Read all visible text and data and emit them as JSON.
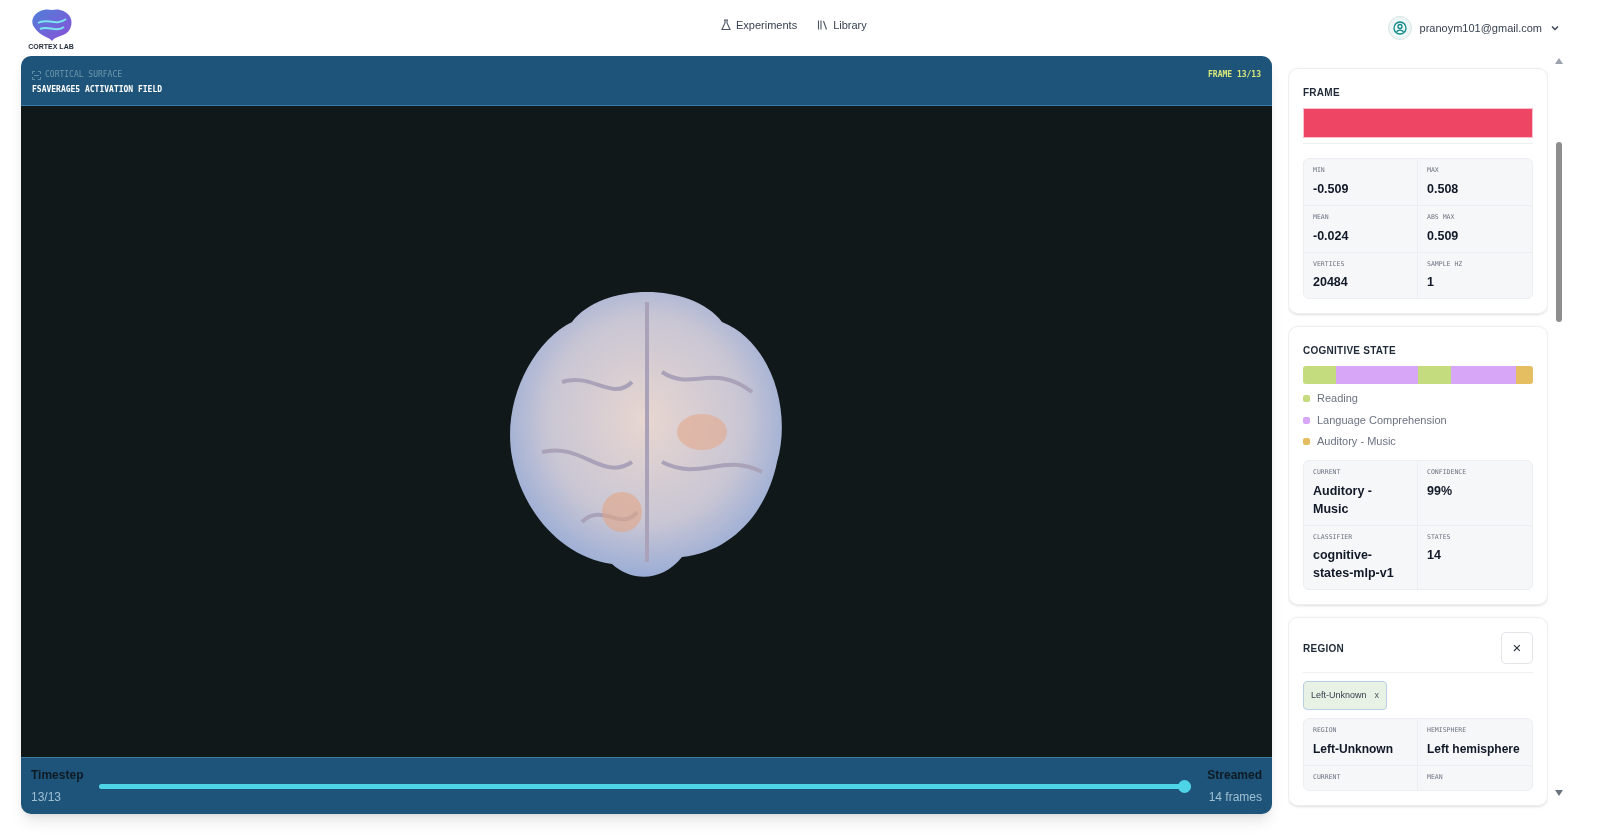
{
  "header": {
    "logo_text": "CORTEX LAB",
    "nav": [
      {
        "label": "Experiments"
      },
      {
        "label": "Library"
      }
    ],
    "account": "pranoym101@gmail.com"
  },
  "viewer": {
    "eyebrow": "CORTICAL SURFACE",
    "title": "FSAVERAGE5 ACTIVATION FIELD",
    "frame_badge": "FRAME 13/13",
    "timestep": {
      "label": "Timestep",
      "value": "13/13",
      "level": 1.0
    },
    "streamed": {
      "label": "Streamed",
      "value": "14 frames"
    }
  },
  "frame": {
    "title": "FRAME",
    "color": "#ef4565",
    "stats": [
      {
        "label": "MIN",
        "value": "-0.509"
      },
      {
        "label": "MAX",
        "value": "0.508"
      },
      {
        "label": "MEAN",
        "value": "-0.024"
      },
      {
        "label": "ABS MAX",
        "value": "0.509"
      },
      {
        "label": "VERTICES",
        "value": "20484"
      },
      {
        "label": "SAMPLE HZ",
        "value": "1"
      }
    ]
  },
  "cognitive_state": {
    "title": "COGNITIVE STATE",
    "frames": [
      {
        "color": "#c5dc7e"
      },
      {
        "color": "#c5dc7e"
      },
      {
        "color": "#d8a6f7"
      },
      {
        "color": "#d8a6f7"
      },
      {
        "color": "#d8a6f7"
      },
      {
        "color": "#d8a6f7"
      },
      {
        "color": "#d8a6f7"
      },
      {
        "color": "#c5dc7e"
      },
      {
        "color": "#c5dc7e"
      },
      {
        "color": "#d8a6f7"
      },
      {
        "color": "#d8a6f7"
      },
      {
        "color": "#d8a6f7"
      },
      {
        "color": "#d8a6f7"
      },
      {
        "color": "#e6be62"
      }
    ],
    "legend": [
      {
        "label": "Reading",
        "color": "#c5dc7e"
      },
      {
        "label": "Language Comprehension",
        "color": "#d8a6f7"
      },
      {
        "label": "Auditory - Music",
        "color": "#e6be62"
      }
    ],
    "stats": [
      {
        "label": "CURRENT",
        "value": "Auditory - Music"
      },
      {
        "label": "CONFIDENCE",
        "value": "99%"
      },
      {
        "label": "CLASSIFIER",
        "value": "cognitive-states-mlp-v1"
      },
      {
        "label": "STATES",
        "value": "14"
      }
    ]
  },
  "region": {
    "title": "REGION",
    "close": "×",
    "chip": {
      "label": "Left-Unknown",
      "remove": "x"
    },
    "stats": [
      {
        "label": "REGION",
        "value": "Left-Unknown"
      },
      {
        "label": "HEMISPHERE",
        "value": "Left hemisphere"
      },
      {
        "label": "CURRENT"
      },
      {
        "label": "MEAN"
      }
    ]
  }
}
